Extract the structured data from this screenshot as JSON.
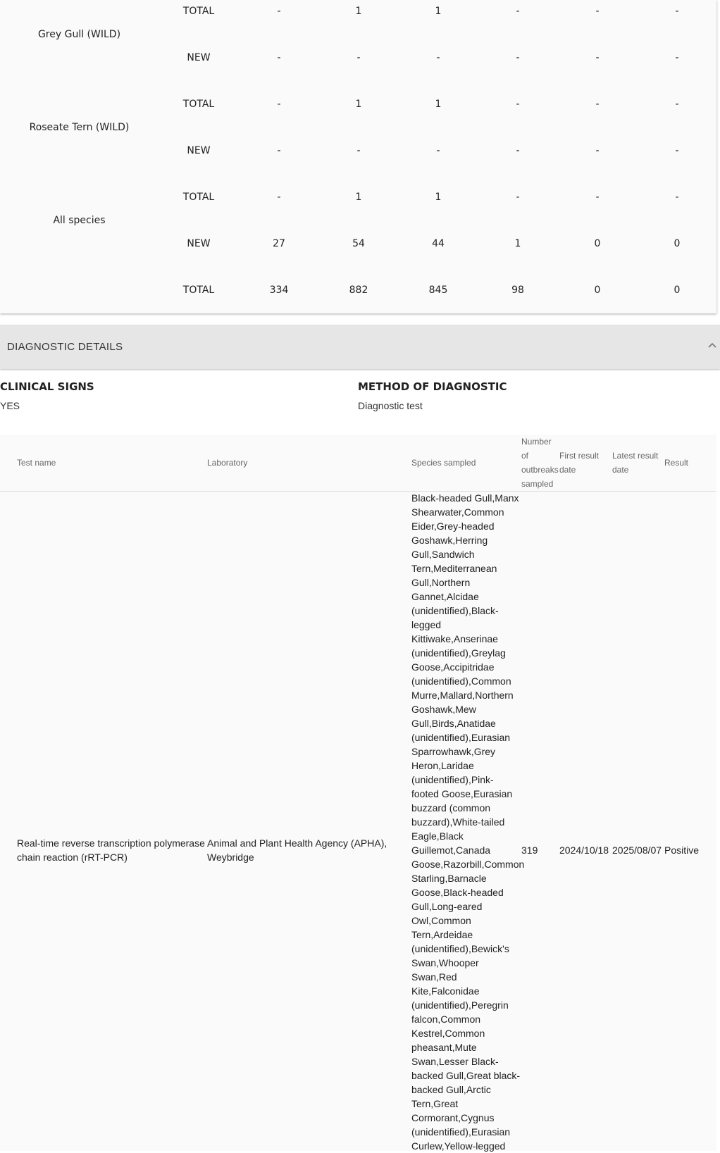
{
  "counts": {
    "rows": [
      {
        "species": "",
        "type": "TOTAL",
        "values": [
          "-",
          "1",
          "1",
          "-",
          "-",
          "-"
        ]
      },
      {
        "species": "Grey Gull (WILD)",
        "type": "NEW",
        "values": [
          "-",
          "-",
          "-",
          "-",
          "-",
          "-"
        ]
      },
      {
        "species": "",
        "type": "TOTAL",
        "values": [
          "-",
          "1",
          "1",
          "-",
          "-",
          "-"
        ]
      },
      {
        "species": "Roseate Tern (WILD)",
        "type": "NEW",
        "values": [
          "-",
          "-",
          "-",
          "-",
          "-",
          "-"
        ]
      },
      {
        "species": "",
        "type": "TOTAL",
        "values": [
          "-",
          "1",
          "1",
          "-",
          "-",
          "-"
        ]
      },
      {
        "species": "All species",
        "type": "NEW",
        "values": [
          "27",
          "54",
          "44",
          "1",
          "0",
          "0"
        ]
      },
      {
        "species": "",
        "type": "TOTAL",
        "values": [
          "334",
          "882",
          "845",
          "98",
          "0",
          "0"
        ]
      }
    ]
  },
  "diagnostic": {
    "section_title": "DIAGNOSTIC DETAILS",
    "clinical_signs_label": "CLINICAL SIGNS",
    "clinical_signs_value": "YES",
    "method_label": "METHOD OF DIAGNOSTIC",
    "method_value": "Diagnostic test",
    "columns": {
      "test_name": "Test name",
      "laboratory": "Laboratory",
      "species_sampled": "Species sampled",
      "outbreaks_sampled_lines": [
        "Number",
        "of",
        "outbreaks",
        "sampled"
      ],
      "first_result_lines": [
        "First result",
        "date"
      ],
      "latest_result_lines": [
        "Latest result",
        "date"
      ],
      "result": "Result"
    },
    "row": {
      "test_name_lines": [
        "Real-time reverse transcription polymerase",
        "chain reaction (rRT-PCR)"
      ],
      "laboratory_lines": [
        "Animal and Plant Health Agency (APHA),",
        "Weybridge"
      ],
      "species_lines": [
        "Black-headed Gull,Manx",
        "Shearwater,Common",
        "Eider,Grey-headed",
        "Goshawk,Herring",
        "Gull,Sandwich",
        "Tern,Mediterranean",
        "Gull,Northern",
        "Gannet,Alcidae",
        "(unidentified),Black-",
        "legged",
        "Kittiwake,Anserinae",
        "(unidentified),Greylag",
        "Goose,Accipitridae",
        "(unidentified),Common",
        "Murre,Mallard,Northern",
        "Goshawk,Mew",
        "Gull,Birds,Anatidae",
        "(unidentified),Eurasian",
        "Sparrowhawk,Grey",
        "Heron,Laridae",
        "(unidentified),Pink-",
        "footed Goose,Eurasian",
        "buzzard (common",
        "buzzard),White-tailed",
        "Eagle,Black",
        "Guillemot,Canada",
        "Goose,Razorbill,Common",
        "Starling,Barnacle",
        "Goose,Black-headed",
        "Gull,Long-eared",
        "Owl,Common",
        "Tern,Ardeidae",
        "(unidentified),Bewick's",
        "Swan,Whooper",
        "Swan,Red",
        "Kite,Falconidae",
        "(unidentified),Peregrin",
        "falcon,Common",
        "Kestrel,Common",
        "pheasant,Mute",
        "Swan,Lesser Black-",
        "backed Gull,Great black-",
        "backed Gull,Arctic",
        "Tern,Great",
        "Cormorant,Cygnus",
        "(unidentified),Eurasian",
        "Curlew,Yellow-legged"
      ],
      "outbreaks_sampled": "319",
      "first_result_date": "2024/10/18",
      "latest_result_date": "2025/08/07",
      "result": "Positive"
    }
  }
}
